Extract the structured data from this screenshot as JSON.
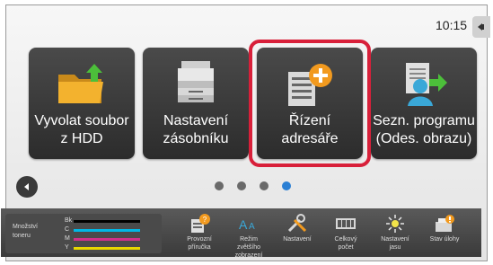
{
  "status": {
    "time": "10:15"
  },
  "tiles": [
    {
      "label": "Vyvolat soubor\nz HDD",
      "icon": "folder-upload-icon"
    },
    {
      "label": "Nastavení\nzásobníku",
      "icon": "printer-tray-icon"
    },
    {
      "label": "Řízení\nadresáře",
      "icon": "address-book-add-icon"
    },
    {
      "label": "Sezn. programu\n(Odes. obrazu)",
      "icon": "send-program-icon"
    }
  ],
  "pager": {
    "pages": 4,
    "active_page": 4
  },
  "toner": {
    "title": "Množství\ntoneru",
    "colors": [
      {
        "name": "Bk",
        "hex": "#000000"
      },
      {
        "name": "C",
        "hex": "#00b8e6"
      },
      {
        "name": "M",
        "hex": "#d0308a"
      },
      {
        "name": "Y",
        "hex": "#e8d800"
      }
    ]
  },
  "bottom_icons": [
    {
      "label": "Provozní\npříručka",
      "icon": "manual-icon"
    },
    {
      "label": "Režim\nzvětšího\nzobrazení",
      "icon": "zoom-mode-icon"
    },
    {
      "label": "Nastavení",
      "icon": "tools-icon"
    },
    {
      "label": "Celkový\npočet",
      "icon": "counter-icon"
    },
    {
      "label": "Nastavení\njasu",
      "icon": "brightness-icon"
    },
    {
      "label": "Stav úlohy",
      "icon": "job-status-icon"
    }
  ],
  "colors": {
    "highlight": "#d8203a",
    "active_dot": "#2a7fd4",
    "tile_bg": "#333333"
  }
}
